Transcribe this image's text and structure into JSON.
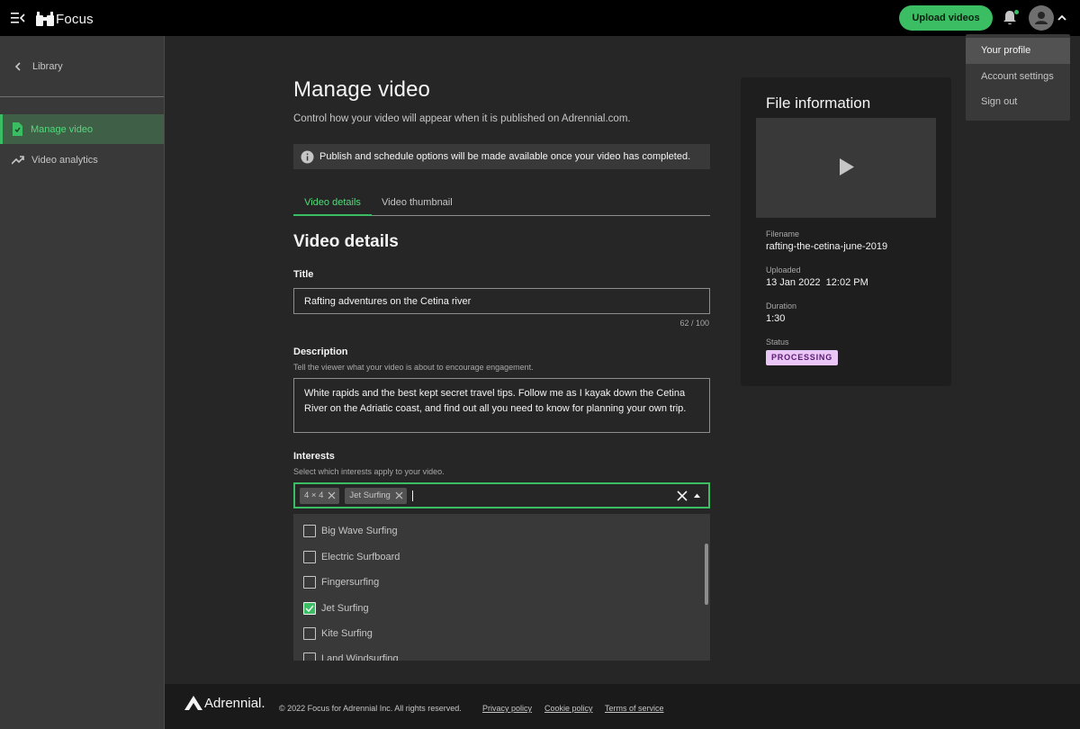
{
  "header": {
    "app_name": "Focus",
    "upload_label": "Upload videos",
    "profile_menu": [
      {
        "label": "Your profile",
        "active": true
      },
      {
        "label": "Account settings",
        "active": false
      },
      {
        "label": "Sign out",
        "active": false
      }
    ]
  },
  "sidebar": {
    "back_label": "Library",
    "items": [
      {
        "label": "Manage video",
        "icon": "file-icon",
        "active": true
      },
      {
        "label": "Video analytics",
        "icon": "trend-icon",
        "active": false
      }
    ]
  },
  "main": {
    "title": "Manage video",
    "subtitle": "Control how your video will appear when it is published on Adrennial.com.",
    "notice": "Publish and schedule options will be made available once your video has completed.",
    "tabs": [
      {
        "label": "Video details",
        "active": true
      },
      {
        "label": "Video thumbnail",
        "active": false
      }
    ],
    "section_title": "Video details",
    "title_field": {
      "label": "Title",
      "value": "Rafting adventures on the Cetina river",
      "counter": "62 / 100"
    },
    "description_field": {
      "label": "Description",
      "help": "Tell the viewer what your video is about to encourage engagement.",
      "value": "White rapids and the best kept secret travel tips. Follow me as I kayak down the Cetina River on the Adriatic coast, and find out all you need to know for planning your own trip."
    },
    "interests_field": {
      "label": "Interests",
      "help": "Select which interests apply to your video.",
      "selected_tags": [
        "4 × 4",
        "Jet Surfing"
      ],
      "options": [
        {
          "label": "Big Wave Surfing",
          "checked": false
        },
        {
          "label": "Electric Surfboard",
          "checked": false
        },
        {
          "label": "Fingersurfing",
          "checked": false
        },
        {
          "label": "Jet Surfing",
          "checked": true
        },
        {
          "label": "Kite Surfing",
          "checked": false
        },
        {
          "label": "Land Windsurfing",
          "checked": false
        }
      ]
    }
  },
  "file_info": {
    "title": "File information",
    "filename_label": "Filename",
    "filename": "rafting-the-cetina-june-2019",
    "uploaded_label": "Uploaded",
    "uploaded": "13 Jan 2022  12:02 PM",
    "duration_label": "Duration",
    "duration": "1:30",
    "status_label": "Status",
    "status": "PROCESSING"
  },
  "footer": {
    "brand": "Adrennial.",
    "copyright": "© 2022 Focus for Adrennial Inc. All rights reserved.",
    "links": [
      "Privacy policy",
      "Cookie policy",
      "Terms of service"
    ]
  },
  "colors": {
    "accent": "#3bbd63",
    "accent_text": "#56d77d",
    "status_badge_bg": "#e9c6f5",
    "status_badge_text": "#5a1a73"
  }
}
